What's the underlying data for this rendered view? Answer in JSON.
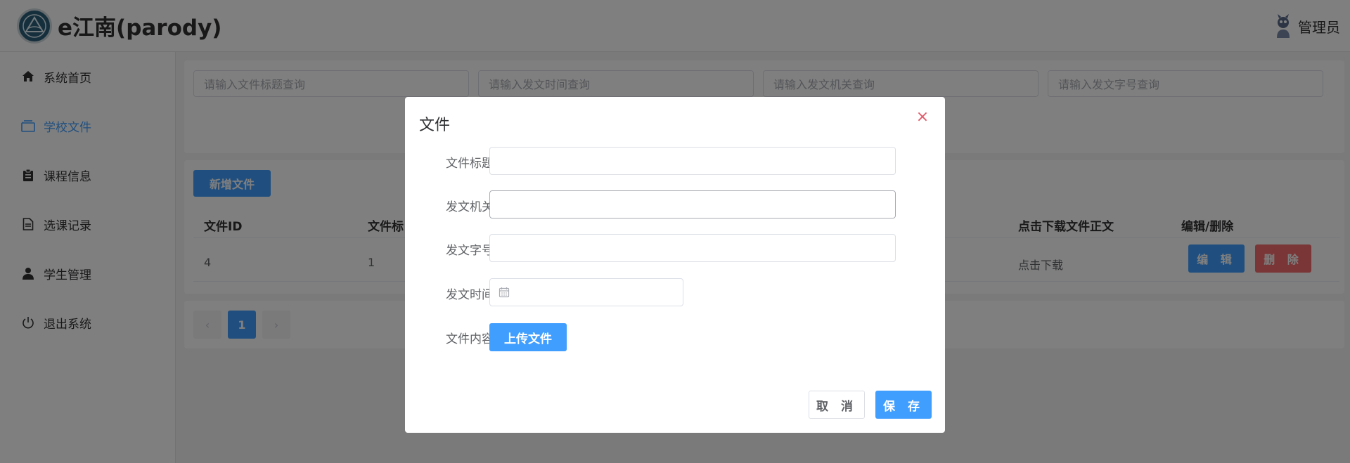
{
  "header": {
    "brand": "e江南(parody)",
    "user_name": "管理员"
  },
  "sidebar": {
    "items": [
      {
        "label": "系统首页",
        "icon": "home-icon"
      },
      {
        "label": "学校文件",
        "icon": "folder-icon",
        "active": true
      },
      {
        "label": "课程信息",
        "icon": "clipboard-icon"
      },
      {
        "label": "选课记录",
        "icon": "document-icon"
      },
      {
        "label": "学生管理",
        "icon": "user-icon"
      },
      {
        "label": "退出系统",
        "icon": "power-icon"
      }
    ]
  },
  "search": {
    "title_placeholder": "请输入文件标题查询",
    "time_placeholder": "请输入发文时间查询",
    "org_placeholder": "请输入发文机关查询",
    "number_placeholder": "请输入发文字号查询"
  },
  "table": {
    "add_label": "新增文件",
    "columns": {
      "id": "文件ID",
      "title": "文件标",
      "download": "点击下载文件正文",
      "actions": "编辑/删除"
    },
    "rows": [
      {
        "id": "4",
        "title": "1",
        "download": "点击下载"
      }
    ],
    "edit_label": "编 辑",
    "delete_label": "删 除"
  },
  "pagination": {
    "prev": "‹",
    "current": "1",
    "next": "›"
  },
  "dialog": {
    "title": "文件",
    "close": "×",
    "fields": {
      "title_label": "文件标题",
      "org_label": "发文机关",
      "number_label": "发文字号",
      "time_label": "发文时间",
      "content_label": "文件内容"
    },
    "upload_label": "上传文件",
    "cancel_label": "取 消",
    "save_label": "保 存"
  },
  "colors": {
    "primary": "#409eff",
    "danger": "#f56c6c",
    "overlay": "rgba(0,0,0,0.5)"
  }
}
